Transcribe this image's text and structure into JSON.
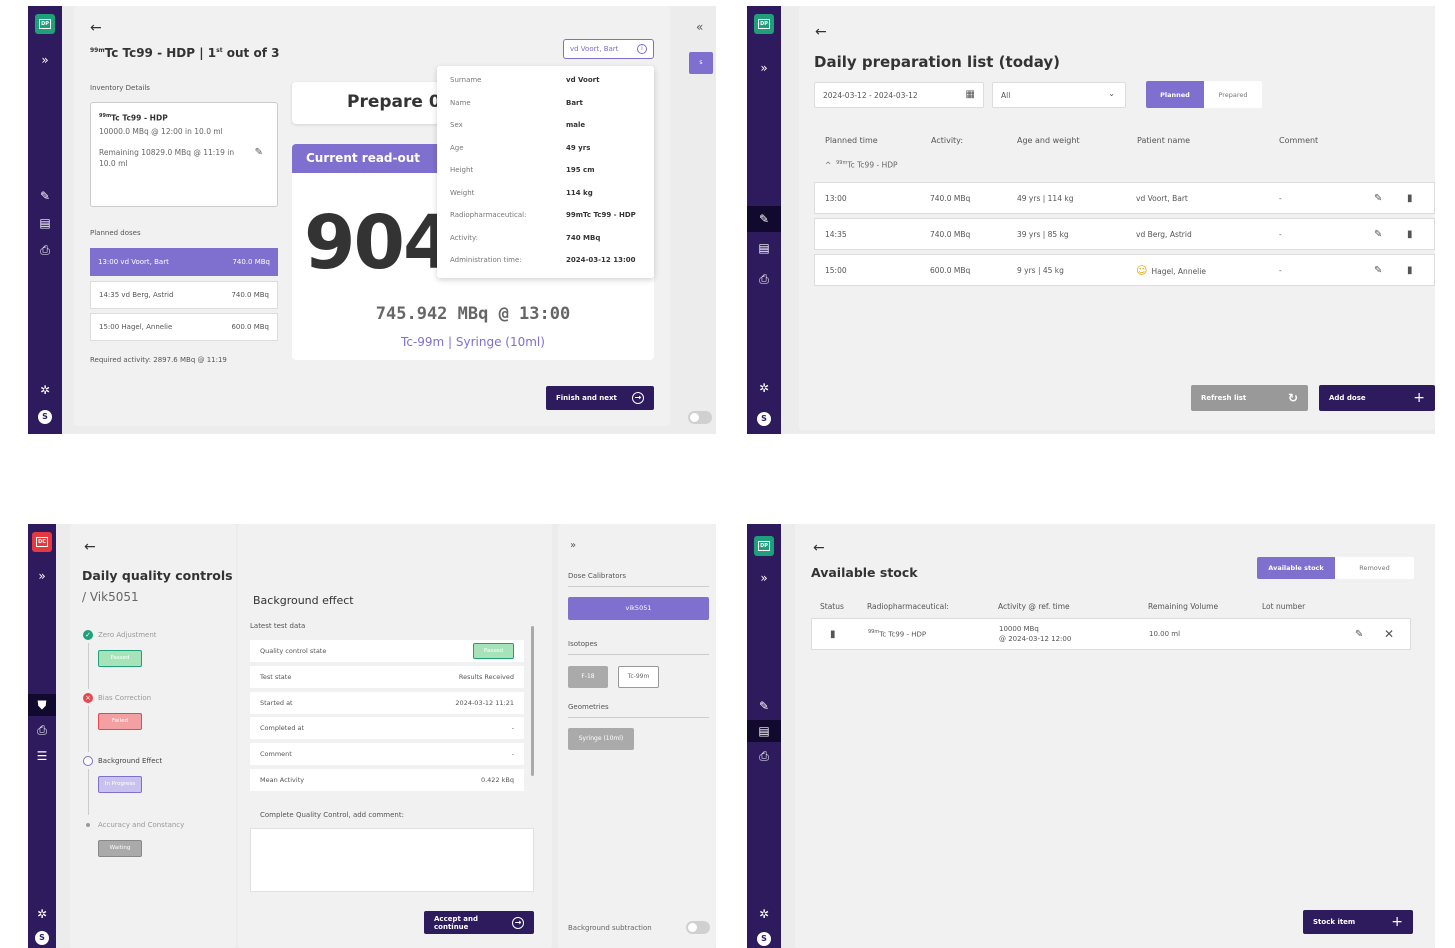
{
  "s1": {
    "rail": {
      "logo": "DP"
    },
    "title_sup": "99m",
    "title_main": "Tc Tc99 - HDP | 1",
    "title_sup2": "st",
    "title_tail": " out of 3",
    "patient_chip": "vd Voort, Bart",
    "inventory_heading": "Inventory Details",
    "inventory": {
      "sup": "99m",
      "name": "Tc Tc99 - HDP",
      "line1": "10000.0 MBq @ 12:00 in 10.0 ml",
      "line2": "Remaining 10829.0 MBq @ 11:19 in 10.0 ml"
    },
    "planned_doses_heading": "Planned doses",
    "doses": [
      {
        "time": "13:00",
        "name": "vd Voort, Bart",
        "activity": "740.0 MBq"
      },
      {
        "time": "14:35",
        "name": "vd Berg, Astrid",
        "activity": "740.0 MBq"
      },
      {
        "time": "15:00",
        "name": "Hagel, Annelie",
        "activity": "600.0 MBq"
      }
    ],
    "required_activity": "Required activity: 2897.6 MBq @ 11:19",
    "prepare_label": "Prepare 0",
    "readout_heading": "Current read-out",
    "readout_big": "904",
    "readout_value": "745.942 MBq @ 13:00",
    "readout_sub": "Tc-99m | Syringe (10ml)",
    "popover": [
      {
        "k": "Surname",
        "v": "vd Voort"
      },
      {
        "k": "Name",
        "v": "Bart"
      },
      {
        "k": "Sex",
        "v": "male"
      },
      {
        "k": "Age",
        "v": "49 yrs"
      },
      {
        "k": "Height",
        "v": "195 cm"
      },
      {
        "k": "Weight",
        "v": "114 kg"
      },
      {
        "k": "Radiopharmaceutical:",
        "v": "99mTc Tc99 - HDP"
      },
      {
        "k": "Activity:",
        "v": "740 MBq"
      },
      {
        "k": "Administration time:",
        "v": "2024-03-12 13:00"
      }
    ],
    "finish_label": "Finish and next",
    "side_collapse": "«",
    "side_badge": "s",
    "avatar": "S"
  },
  "s2": {
    "rail": {
      "logo": "DP"
    },
    "title": "Daily preparation list (today)",
    "date_range": "2024-03-12 - 2024-03-12",
    "filter_value": "All",
    "seg_planned": "Planned",
    "seg_prepared": "Prepared",
    "columns": [
      "Planned time",
      "Activity:",
      "Age and weight",
      "Patient name",
      "Comment"
    ],
    "group_sup": "99m",
    "group_label": "Tc Tc99 - HDP",
    "rows": [
      {
        "time": "13:00",
        "activity": "740.0 MBq",
        "age": "49 yrs | 114 kg",
        "name": "vd Voort, Bart",
        "comment": "-"
      },
      {
        "time": "14:35",
        "activity": "740.0 MBq",
        "age": "39 yrs | 85 kg",
        "name": "vd Berg, Astrid",
        "comment": "-"
      },
      {
        "time": "15:00",
        "activity": "600.0 MBq",
        "age": "9 yrs | 45 kg",
        "name": "Hagel, Annelie",
        "comment": "-"
      }
    ],
    "refresh_label": "Refresh list",
    "add_dose_label": "Add dose",
    "avatar": "S"
  },
  "s3": {
    "rail": {
      "logo": "DC"
    },
    "title": "Daily quality controls",
    "subtitle": "/ Vik5051",
    "steps": [
      {
        "label": "Zero Adjustment",
        "status": "Passed",
        "state": "passed"
      },
      {
        "label": "Bias Correction",
        "status": "Failed",
        "state": "failed"
      },
      {
        "label": "Background Effect",
        "status": "In Progress",
        "state": "progress"
      },
      {
        "label": "Accuracy and Constancy",
        "status": "Waiting",
        "state": "waiting"
      }
    ],
    "section_title": "Background effect",
    "latest_label": "Latest test data",
    "test_rows": [
      {
        "k": "Quality control state",
        "v": "Passed"
      },
      {
        "k": "Test state",
        "v": "Results Received"
      },
      {
        "k": "Started at",
        "v": "2024-03-12 11:21"
      },
      {
        "k": "Completed at",
        "v": "-"
      },
      {
        "k": "Comment",
        "v": "-"
      },
      {
        "k": "Mean Activity",
        "v": "0.422 kBq"
      }
    ],
    "complete_label": "Complete Quality Control, add comment:",
    "accept_label": "Accept and continue",
    "right": {
      "expand": "»",
      "dose_cal_heading": "Dose Calibrators",
      "dose_cal_selected": "vik5051",
      "isotopes_heading": "Isotopes",
      "isotope_a": "F-18",
      "isotope_b": "Tc-99m",
      "geometries_heading": "Geometries",
      "geometry": "Syringe (10ml)",
      "bg_sub_label": "Background subtraction"
    },
    "avatar": "S"
  },
  "s4": {
    "rail": {
      "logo": "DP"
    },
    "title": "Available stock",
    "seg_available": "Available stock",
    "seg_removed": "Removed",
    "columns": [
      "Status",
      "Radiopharmaceutical:",
      "Activity @ ref. time",
      "Remaining Volume",
      "Lot number"
    ],
    "row": {
      "sup": "99m",
      "name": "Tc Tc99 - HDP",
      "activity_line1": "10000 MBq",
      "activity_line2": "@ 2024-03-12 12:00",
      "volume": "10.00 ml"
    },
    "stock_item_label": "Stock item",
    "avatar": "S"
  },
  "colors": {
    "primary": "#2d1b5e",
    "accent": "#7f6fcf",
    "passed": "#1fa07a",
    "failed": "#e5484d"
  }
}
